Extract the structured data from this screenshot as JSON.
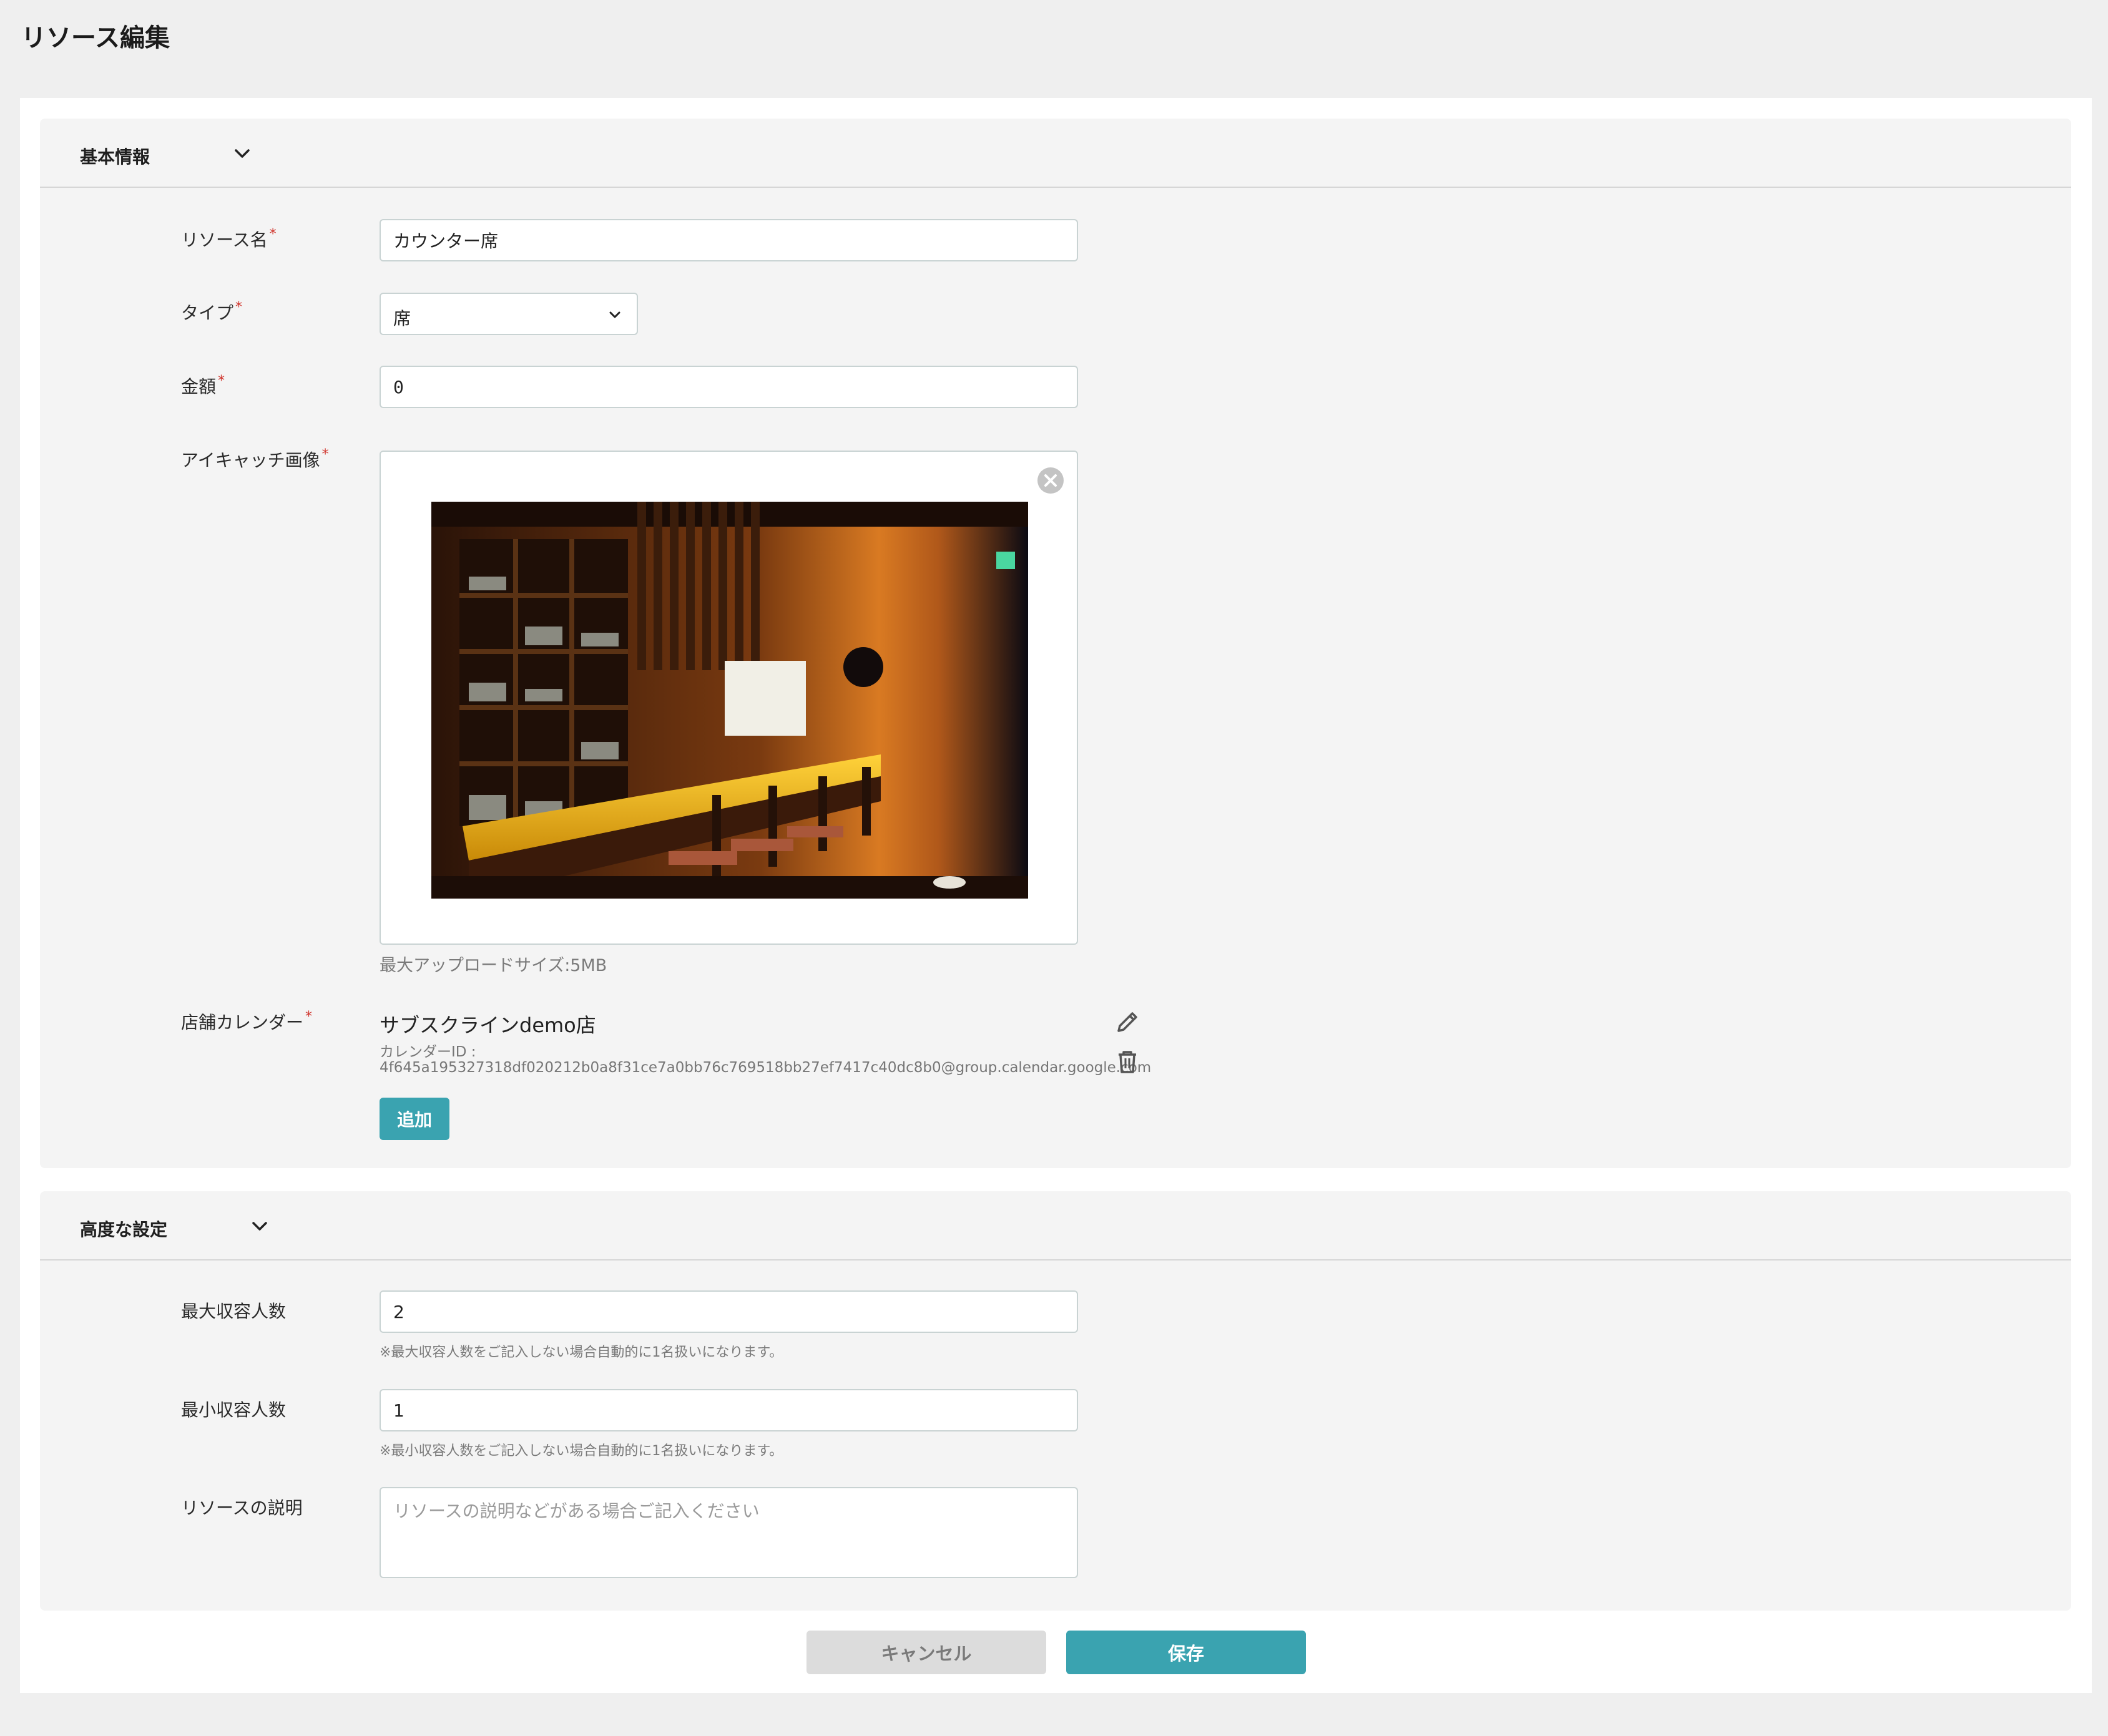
{
  "page": {
    "title": "リソース編集"
  },
  "basic": {
    "title": "基本情報",
    "resource_name": {
      "label": "リソース名",
      "value": "カウンター席"
    },
    "type": {
      "label": "タイプ",
      "value": "席"
    },
    "price": {
      "label": "金額",
      "value": "0"
    },
    "eyecatch": {
      "label": "アイキャッチ画像",
      "hint": "最大アップロードサイズ:5MB"
    },
    "calendar": {
      "label": "店舗カレンダー",
      "name": "サブスクラインdemo店",
      "id_label": "カレンダーID :",
      "id_value": "4f645a195327318df020212b0a8f31ce7a0bb76c769518bb27ef7417c40dc8b0@group.calendar.google.com",
      "add_label": "追加"
    },
    "required_mark": "*"
  },
  "advanced": {
    "title": "高度な設定",
    "max_capacity": {
      "label": "最大収容人数",
      "value": "2",
      "note": "※最大収容人数をご記入しない場合自動的に1名扱いになります。"
    },
    "min_capacity": {
      "label": "最小収容人数",
      "value": "1",
      "note": "※最小収容人数をご記入しない場合自動的に1名扱いになります。"
    },
    "description": {
      "label": "リソースの説明",
      "value": "",
      "placeholder": "リソースの説明などがある場合ご記入ください"
    }
  },
  "actions": {
    "cancel_label": "キャンセル",
    "save_label": "保存"
  },
  "colors": {
    "accent": "#3aa3b0",
    "required": "#d0342c",
    "panel": "#f4f4f4",
    "background": "#efefef"
  },
  "icons": {
    "collapse": "chevron-down-icon",
    "remove": "close-circle-icon",
    "edit": "pencil-icon",
    "delete": "trash-icon"
  }
}
